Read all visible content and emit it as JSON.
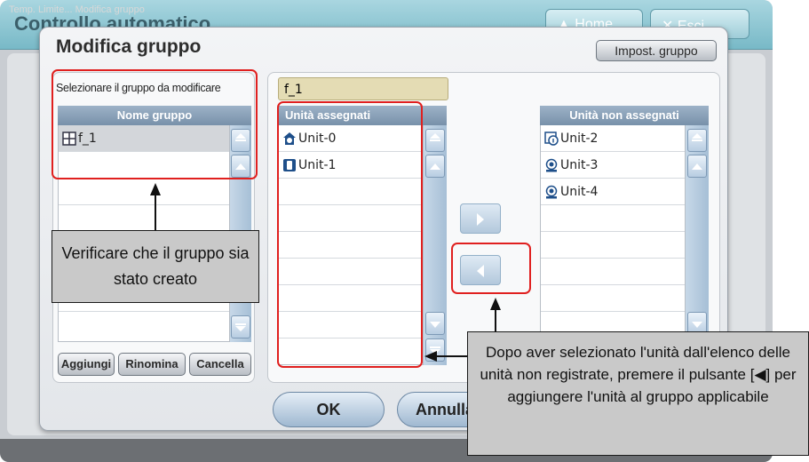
{
  "app": {
    "title": "Controllo automatico",
    "home_label": "Home",
    "exit_label": "Esci",
    "status_text": "Temp. Limite... Modifica gruppo"
  },
  "dialog": {
    "title": "Modifica gruppo",
    "settings_button": "Impost. gruppo",
    "select_label": "Selezionare il gruppo da modificare",
    "group_name_value": "f_1",
    "group_list": {
      "header": "Nome gruppo",
      "items": [
        "f_1"
      ]
    },
    "assigned_list": {
      "header": "Unità assegnati",
      "items": [
        "Unit-0",
        "Unit-1"
      ]
    },
    "unassigned_list": {
      "header": "Unità non assegnati",
      "items": [
        "Unit-2",
        "Unit-3",
        "Unit-4"
      ]
    },
    "buttons": {
      "add": "Aggiungi",
      "rename": "Rinomina",
      "delete": "Cancella",
      "ok": "OK",
      "cancel": "Annulla"
    }
  },
  "callouts": {
    "group_created": "Verificare che il gruppo sia stato creato",
    "add_unit": "Dopo aver selezionato l'unità dall'elenco delle unità non registrate, premere il pulsante [◀] per aggiungere l'unità al gruppo applicabile"
  },
  "colors": {
    "highlight": "#e0201f",
    "list_header": "#7891aa",
    "header_bar": "#78b9c7"
  }
}
